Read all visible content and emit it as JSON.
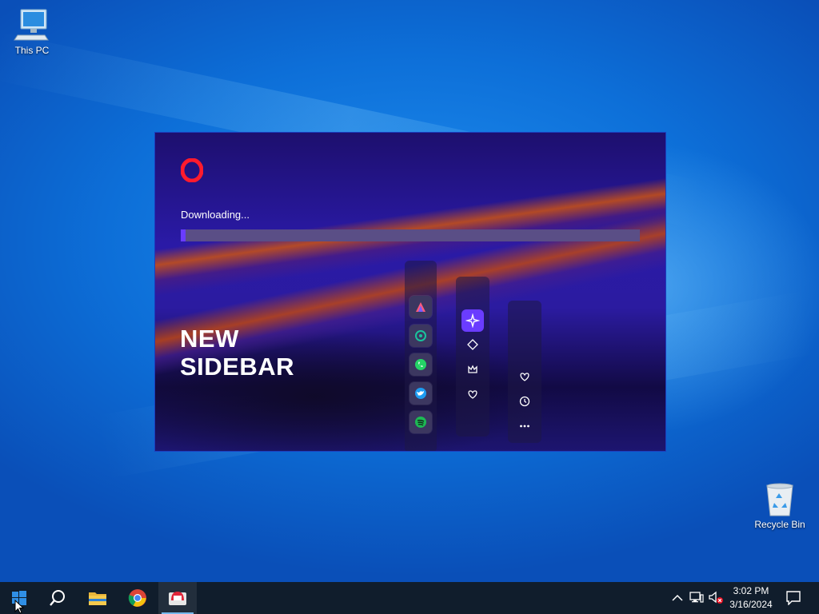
{
  "desktop": {
    "icons": [
      {
        "label": "This PC"
      },
      {
        "label": "Recycle Bin"
      }
    ]
  },
  "installer": {
    "status": "Downloading...",
    "progress": 0.01,
    "promo_title_line1": "NEW",
    "promo_title_line2": "SIDEBAR",
    "brand_color": "#ff1b2d",
    "accent_color": "#6a3cff",
    "sidebar_apps": [
      "aria-icon",
      "chatgpt-icon",
      "whatsapp-icon",
      "twitter-icon",
      "spotify-icon"
    ],
    "sidebar_tools": [
      "ai-sparkle-icon",
      "diamond-icon",
      "crown-icon",
      "heart-shield-icon"
    ],
    "sidebar_utils": [
      "heart-icon",
      "history-clock-icon",
      "more-dots-icon"
    ]
  },
  "taskbar": {
    "pinned": [
      "start-windows-icon",
      "search-icon",
      "file-explorer-icon",
      "chrome-icon",
      "opera-installer-icon"
    ],
    "tray_icons": [
      "chevron-up-icon",
      "network-icon",
      "volume-muted-icon",
      "notifications-icon"
    ],
    "time": "3:02 PM",
    "date": "3/16/2024"
  }
}
